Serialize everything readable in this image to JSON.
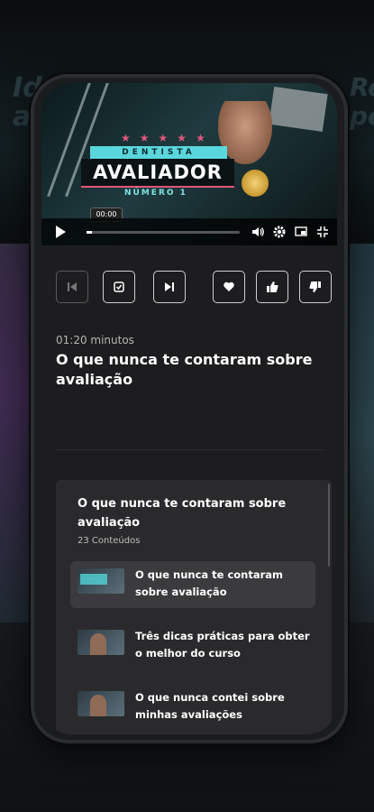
{
  "background": {
    "words": [
      "Ide",
      "ar",
      "Rea",
      "pe"
    ]
  },
  "video": {
    "headline_top": "DENTISTA",
    "headline_main": "AVALIADOR",
    "headline_sub": "NÚMERO 1",
    "current_time": "00:00",
    "progress_fraction": 0.0,
    "icons": [
      "play-icon",
      "volume-icon",
      "settings-icon",
      "cast-icon",
      "fullscreen-exit-icon"
    ]
  },
  "actions": {
    "icons": [
      "previous-icon",
      "check-icon",
      "next-icon",
      "heart-icon",
      "thumbs-up-icon",
      "thumbs-down-icon"
    ]
  },
  "lesson": {
    "duration": "01:20 minutos",
    "title": "O que nunca te contaram sobre avaliação"
  },
  "playlist": {
    "title": "O que nunca te contaram sobre avaliação",
    "count": "23 Conteúdos",
    "items": [
      {
        "label": "O que nunca te contaram sobre avaliação",
        "active": true
      },
      {
        "label": "Três dicas práticas para obter o melhor do curso",
        "active": false
      },
      {
        "label": "O que nunca contei sobre minhas avaliações",
        "active": false
      }
    ]
  },
  "colors": {
    "accent": "#5ad7dc",
    "stars": "#e0577a",
    "card": "#2a2a2c",
    "active_item": "#3b3b3d"
  }
}
